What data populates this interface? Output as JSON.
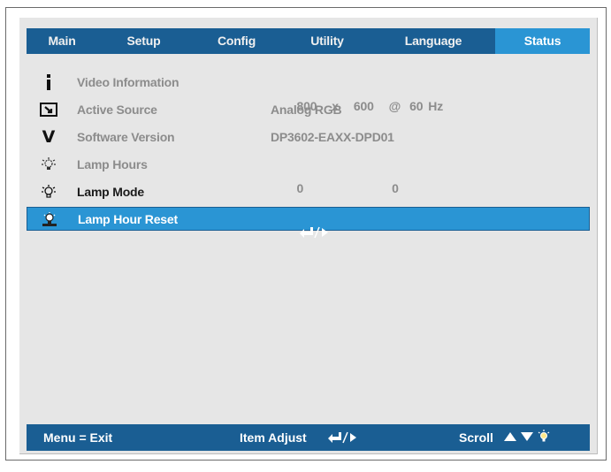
{
  "tabs": [
    {
      "label": "Main"
    },
    {
      "label": "Setup"
    },
    {
      "label": "Config"
    },
    {
      "label": "Utility"
    },
    {
      "label": "Language"
    },
    {
      "label": "Status",
      "active": true
    }
  ],
  "rows": [
    {
      "icon": "info-icon",
      "label": "Video Information",
      "value_parts": [
        "800",
        "x",
        "600",
        "@",
        "60",
        "Hz"
      ],
      "enabled": false
    },
    {
      "icon": "source-icon",
      "label": "Active Source",
      "value": "Analog RGB",
      "enabled": false
    },
    {
      "icon": "version-icon",
      "icon_glyph": "V",
      "label": "Software Version",
      "value": "DP3602-EAXX-DPD01",
      "enabled": false
    },
    {
      "icon": "lamp-icon",
      "label": "Lamp Hours",
      "value_parts": [
        "0",
        "0"
      ],
      "enabled": false
    },
    {
      "icon": "lamp-mode-icon",
      "label": "Lamp Mode",
      "value": "",
      "enabled": true
    },
    {
      "icon": "lamp-reset-icon",
      "label": "Lamp Hour Reset",
      "value_icon": "enter-right-arrow-icon",
      "enabled": true,
      "selected": true
    }
  ],
  "footer": {
    "menu_exit": "Menu = Exit",
    "item_adjust": "Item Adjust",
    "item_adjust_icon": "enter-right-arrow-icon",
    "scroll": "Scroll",
    "scroll_icons": [
      "up-arrow-icon",
      "down-arrow-icon",
      "lamp-icon"
    ]
  },
  "colors": {
    "bar": "#1a5e93",
    "accent": "#2a95d4",
    "panel": "#e6e6e6",
    "disabled_text": "#8c8c8c"
  }
}
